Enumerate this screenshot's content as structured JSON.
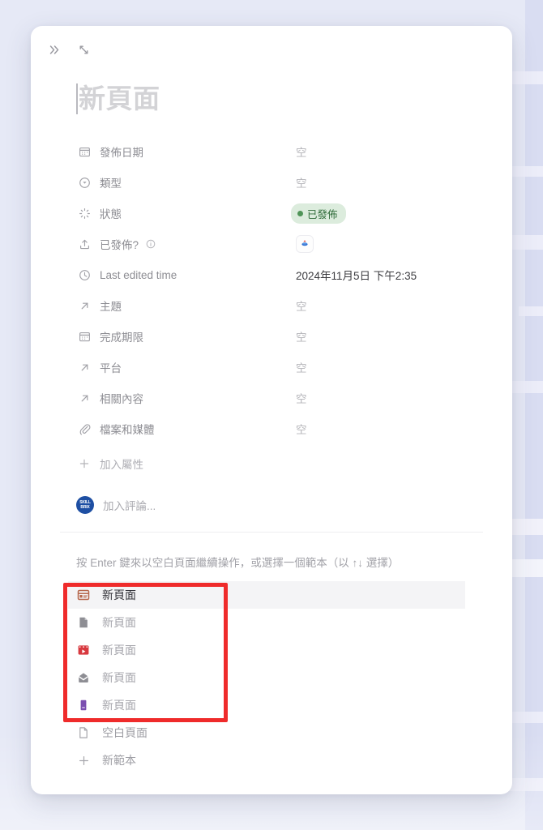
{
  "window": {
    "background_color": "#e6e9f6",
    "card_background": "#ffffff"
  },
  "topbar": {
    "collapse_label": "»",
    "collapse_icon": "double-chevron-right-icon",
    "expand_icon": "expand-diagonal-icon"
  },
  "title": {
    "placeholder": "新頁面"
  },
  "properties": [
    {
      "icon": "calendar-icon",
      "name": "發佈日期",
      "value": "空",
      "type": "text",
      "info": false
    },
    {
      "icon": "select-circle-icon",
      "name": "類型",
      "value": "空",
      "type": "text",
      "info": false
    },
    {
      "icon": "status-sparkle-icon",
      "name": "狀態",
      "value": "已發佈",
      "type": "badge",
      "info": false
    },
    {
      "icon": "upload-icon",
      "name": "已發佈?",
      "value": "",
      "type": "appicon",
      "info": true
    },
    {
      "icon": "clock-icon",
      "name": "Last edited time",
      "value": "2024年11月5日 下午2:35",
      "type": "datetime",
      "info": false
    },
    {
      "icon": "relation-arrow-icon",
      "name": "主題",
      "value": "空",
      "type": "text",
      "info": false
    },
    {
      "icon": "calendar-icon",
      "name": "完成期限",
      "value": "空",
      "type": "text",
      "info": false
    },
    {
      "icon": "relation-arrow-icon",
      "name": "平台",
      "value": "空",
      "type": "text",
      "info": false
    },
    {
      "icon": "relation-arrow-icon",
      "name": "相關內容",
      "value": "空",
      "type": "text",
      "info": false
    },
    {
      "icon": "paperclip-icon",
      "name": "檔案和媒體",
      "value": "空",
      "type": "text",
      "info": false
    }
  ],
  "add_property": {
    "icon": "plus-icon",
    "label": "加入屬性"
  },
  "comment": {
    "avatar_initials": "SKILL\nBRIX",
    "placeholder": "加入評論..."
  },
  "hint": {
    "text": "按 Enter 鍵來以空白頁面繼續操作，或選擇一個範本（以 ↑↓ 選擇）"
  },
  "templates": {
    "highlight_color": "#ef2b2b",
    "items": [
      {
        "icon": "template-card-icon",
        "icon_color": "#b5654a",
        "label": "新頁面",
        "selected": true,
        "in_highlight": true
      },
      {
        "icon": "template-doc-icon",
        "icon_color": "#8e8e94",
        "label": "新頁面",
        "selected": false,
        "in_highlight": true
      },
      {
        "icon": "template-video-icon",
        "icon_color": "#d8393f",
        "label": "新頁面",
        "selected": false,
        "in_highlight": true
      },
      {
        "icon": "template-envelope-icon",
        "icon_color": "#8e8e94",
        "label": "新頁面",
        "selected": false,
        "in_highlight": true
      },
      {
        "icon": "template-book-icon",
        "icon_color": "#7b4fb0",
        "label": "新頁面",
        "selected": false,
        "in_highlight": true
      }
    ],
    "footer_items": [
      {
        "icon": "blank-page-icon",
        "label": "空白頁面"
      },
      {
        "icon": "plus-icon",
        "label": "新範本"
      }
    ]
  }
}
